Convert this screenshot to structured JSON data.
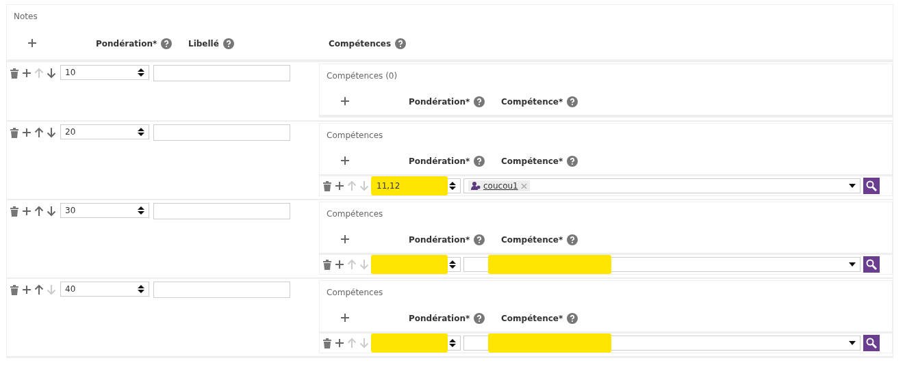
{
  "section": {
    "title": "Notes"
  },
  "header": {
    "columns": [
      "Pondération*",
      "Libellé",
      "Compétences"
    ]
  },
  "rows": [
    {
      "weight": "10",
      "up_disabled": true,
      "down_disabled": false,
      "competences": {
        "title": "Compétences (0)",
        "columns": [
          "Pondération*",
          "Compétence*"
        ]
      }
    },
    {
      "weight": "20",
      "up_disabled": false,
      "down_disabled": false,
      "competences": {
        "title": "Compétences",
        "columns": [
          "Pondération*",
          "Compétence*"
        ],
        "items": [
          {
            "weight": "11,12",
            "weight_highlighted": true,
            "tag": "coucou1",
            "competence_highlighted": false,
            "up_disabled": true,
            "down_disabled": true
          }
        ]
      }
    },
    {
      "weight": "30",
      "up_disabled": false,
      "down_disabled": false,
      "competences": {
        "title": "Compétences",
        "columns": [
          "Pondération*",
          "Compétence*"
        ],
        "items": [
          {
            "weight_highlighted": true,
            "competence_highlighted": true,
            "up_disabled": true,
            "down_disabled": true
          }
        ]
      }
    },
    {
      "weight": "40",
      "up_disabled": false,
      "down_disabled": true,
      "competences": {
        "title": "Compétences",
        "columns": [
          "Pondération*",
          "Compétence*"
        ],
        "items": [
          {
            "weight_highlighted": true,
            "competence_highlighted": true,
            "up_disabled": true,
            "down_disabled": true
          }
        ]
      }
    }
  ]
}
